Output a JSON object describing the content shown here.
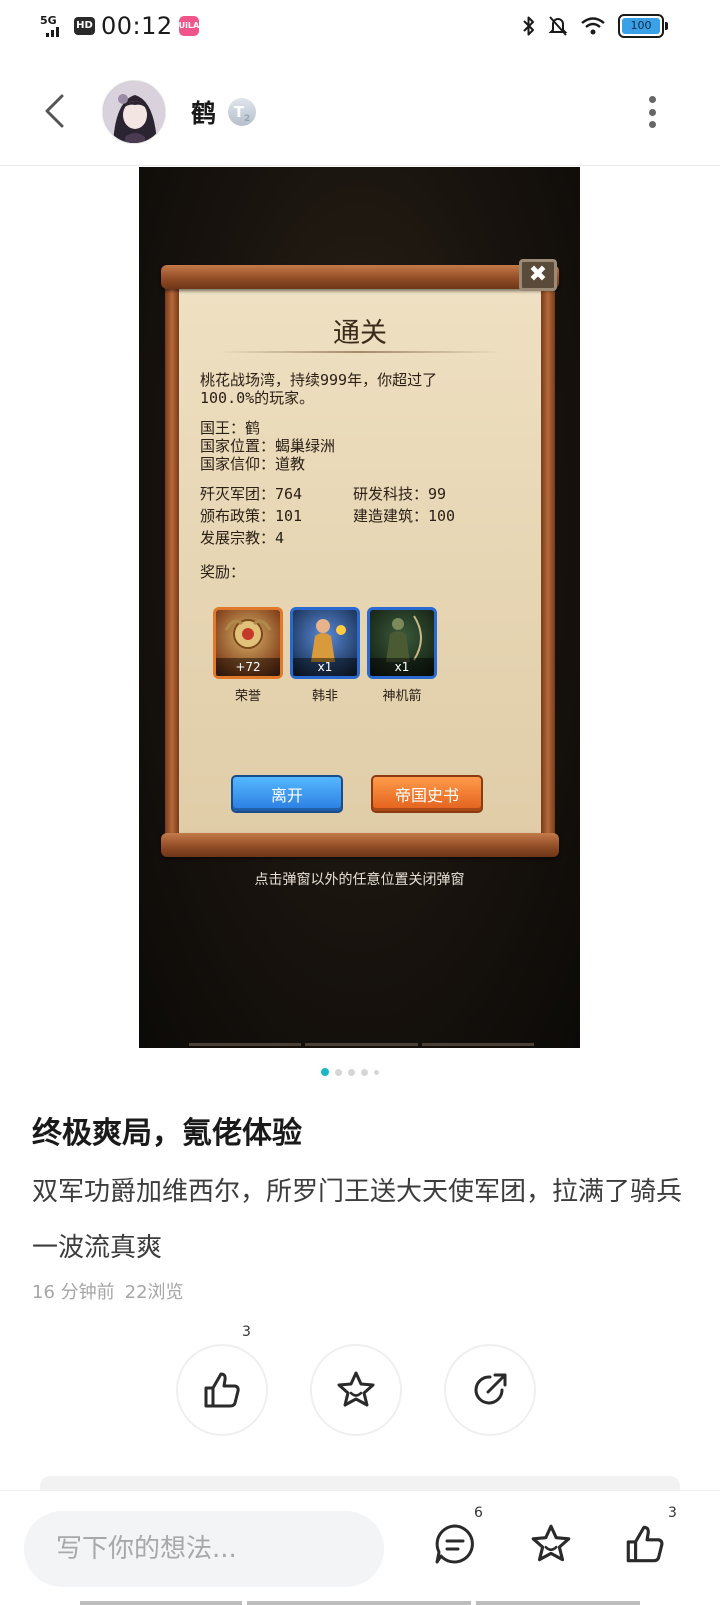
{
  "status_bar": {
    "network": "5G",
    "hd": "HD",
    "time": "00:12",
    "app_badge": "UiLA",
    "battery": "100"
  },
  "header": {
    "username": "鹤",
    "level": "T",
    "level_sub": "2"
  },
  "game": {
    "title": "通关",
    "summary_line1": "桃花战场湾，持续999年，你超过了",
    "summary_line2": "100.0%的玩家。",
    "king": "国王：鹤",
    "location": "国家位置：蝎巢绿洲",
    "belief": "国家信仰：道教",
    "stats": [
      {
        "label": "歼灭军团：764"
      },
      {
        "label": "研发科技：99"
      },
      {
        "label": "颁布政策：101"
      },
      {
        "label": "建造建筑：100"
      },
      {
        "label": "发展宗教：4"
      }
    ],
    "reward_label": "奖励：",
    "rewards": [
      {
        "name": "荣誉",
        "qty": "+72",
        "style": "orange"
      },
      {
        "name": "韩非",
        "qty": "x1",
        "style": "blue"
      },
      {
        "name": "神机箭",
        "qty": "x1",
        "style": "blue2"
      }
    ],
    "leave_button": "离开",
    "history_button": "帝国史书",
    "close_hint": "点击弹窗以外的任意位置关闭弹窗"
  },
  "post": {
    "title": "终极爽局，氪佬体验",
    "body": "双军功爵加维西尔，所罗门王送大天使军团，拉满了骑兵一波流真爽",
    "time": "16 分钟前",
    "views": "22浏览"
  },
  "actions": {
    "like_count": "3"
  },
  "bottom_bar": {
    "placeholder": "写下你的想法...",
    "comment_count": "6",
    "like_count": "3"
  },
  "colors": {
    "accent": "#19b6c8",
    "leave_button": "#2a7ce0",
    "history_button": "#e2601c"
  }
}
